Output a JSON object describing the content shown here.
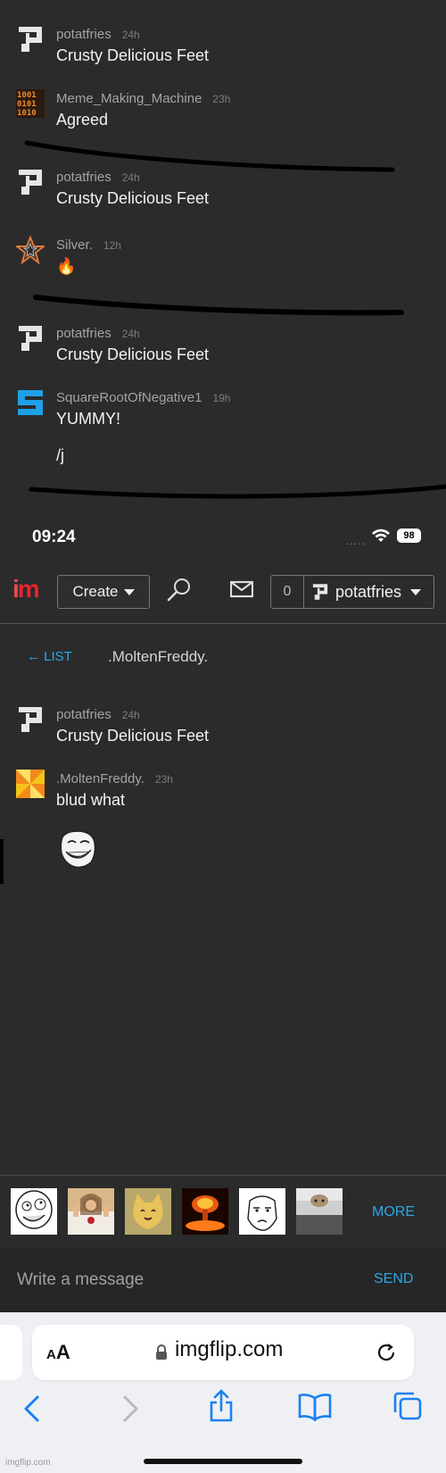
{
  "chat_history": [
    {
      "user": "potatfries",
      "age": "24h",
      "text": "Crusty Delicious Feet",
      "avatar": "potatfries-p-icon"
    },
    {
      "user": "Meme_Making_Machine",
      "age": "23h",
      "text": "Agreed",
      "avatar": "binary-avatar-icon"
    },
    {
      "user": "potatfries",
      "age": "24h",
      "text": "Crusty Delicious Feet",
      "avatar": "potatfries-p-icon"
    },
    {
      "user": "Silver.",
      "age": "12h",
      "text": "🔥",
      "avatar": "star-avatar-icon"
    },
    {
      "user": "potatfries",
      "age": "24h",
      "text": "Crusty Delicious Feet",
      "avatar": "potatfries-p-icon"
    },
    {
      "user": "SquareRootOfNegative1",
      "age": "19h",
      "text": "YUMMY!",
      "text2": "/j",
      "avatar": "blue-s-avatar-icon"
    }
  ],
  "status_bar": {
    "time": "09:24",
    "battery": "98",
    "signal": "....."
  },
  "nav": {
    "create_label": "Create",
    "notif_count": "0",
    "username": "potatfries"
  },
  "conversation": {
    "back_label": "LIST",
    "back_arrow": "←",
    "title": ".MoltenFreddy.",
    "messages": [
      {
        "user": "potatfries",
        "age": "24h",
        "text": "Crusty Delicious Feet",
        "avatar": "potatfries-p-icon"
      },
      {
        "user": ".MoltenFreddy.",
        "age": "23h",
        "text": "blud what",
        "avatar": "pinwheel-avatar-icon",
        "image": "trollface-meme-icon"
      }
    ]
  },
  "meme_strip": {
    "thumbs": [
      "derp-meme",
      "buddy-christ-meme",
      "happy-cat-meme",
      "nuke-explosion-meme",
      "okay-guy-meme",
      "ceiling-cat-meme"
    ],
    "more_label": "MORE"
  },
  "composer": {
    "placeholder": "Write a message",
    "send_label": "SEND"
  },
  "browser": {
    "domain": "imgflip.com",
    "aa_small": "A",
    "aa_large": "A"
  },
  "watermark": "imgflip.com",
  "colors": {
    "background": "#2b2b2b",
    "accent": "#2ba7e8",
    "logo_red": "#e8232d"
  }
}
